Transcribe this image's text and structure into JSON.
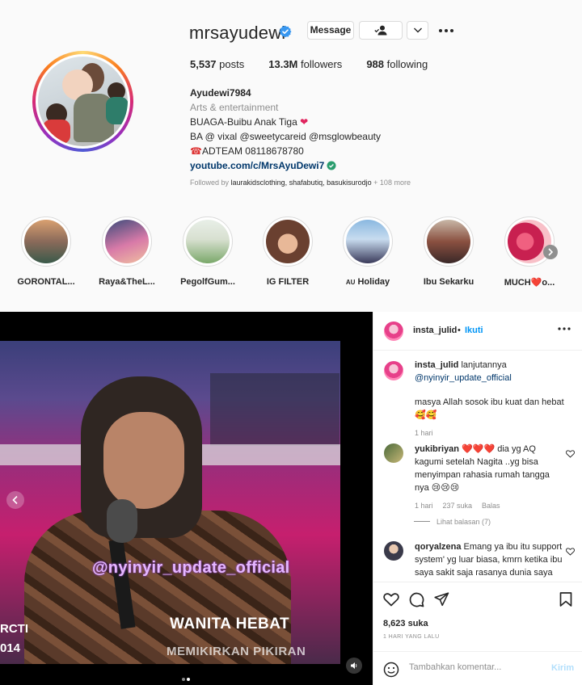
{
  "profile": {
    "username": "mrsayudewi",
    "message_label": "Message",
    "stats": {
      "posts_value": "5,537",
      "posts_label": "posts",
      "followers_value": "13.3M",
      "followers_label": "followers",
      "following_value": "988",
      "following_label": "following"
    },
    "bio": {
      "name": "Ayudewi7984",
      "category": "Arts & entertainment",
      "line1": "BUAGA-Buibu Anak Tiga",
      "line2": "BA @ vixal @sweetycareid @msglowbeauty",
      "line3": "ADTEAM 08118678780",
      "link": "youtube.com/c/MrsAyuDewi7"
    },
    "followed_by_prefix": "Followed by",
    "followed_by_names": "laurakidsclothing, shafabutiq, basukisurodjo",
    "followed_by_more": "+ 108 more"
  },
  "highlights": [
    {
      "label": "GORONTAL..."
    },
    {
      "label": "Raya&TheL..."
    },
    {
      "label": "PegolfGum..."
    },
    {
      "label": "IG FILTER"
    },
    {
      "label": "Holiday"
    },
    {
      "label": "Ibu Sekarku"
    },
    {
      "label": "MUCH❤️o..."
    }
  ],
  "post": {
    "video": {
      "watermark": "@nyinyir_update_official",
      "caption1": "WANITA HEBAT",
      "caption2": "MEMIKIRKAN PIKIRAN",
      "tv_logo": "RCTI",
      "tv_year": "014"
    },
    "header": {
      "username": "insta_julid",
      "separator": "•",
      "follow_label": "Ikuti"
    },
    "caption": {
      "username": "insta_julid",
      "text1": "lanjutannya",
      "mention": "@nyinyir_update_official",
      "text2": "masya Allah sosok ibu kuat dan hebat 🥰🥰",
      "time": "1 hari"
    },
    "comments": [
      {
        "username": "yukibriyan",
        "text": "❤️❤️❤️ dia yg AQ kagumi setelah Nagita ..yg bisa menyimpan rahasia rumah tangga nya 😢😢😢",
        "time": "1 hari",
        "likes": "237 suka",
        "reply": "Balas",
        "view_replies": "Lihat balasan (7)"
      },
      {
        "username": "qoryalzena",
        "text": "Emang ya ibu itu support system' yg luar biasa, kmrn ketika ibu saya sakit saja rasanya dunia saya seperti berhenti, di"
      }
    ],
    "likes": "8,623 suka",
    "time": "1 HARI YANG LALU",
    "comment_placeholder": "Tambahkan komentar...",
    "send_label": "Kirim"
  }
}
